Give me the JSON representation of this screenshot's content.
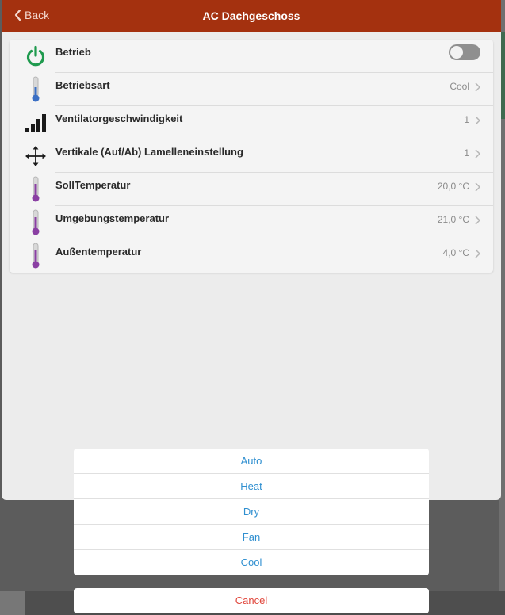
{
  "header": {
    "back_label": "Back",
    "title": "AC Dachgeschoss"
  },
  "rows": [
    {
      "label": "Betrieb",
      "value": "",
      "icon": "power-icon",
      "control": "toggle",
      "toggle_on": false
    },
    {
      "label": "Betriebsart",
      "value": "Cool",
      "icon": "thermometer-blue-icon"
    },
    {
      "label": "Ventilatorgeschwindigkeit",
      "value": "1",
      "icon": "signal-bars-icon"
    },
    {
      "label": "Vertikale (Auf/Ab) Lamelleneinstellung",
      "value": "1",
      "icon": "move-arrows-icon"
    },
    {
      "label": "SollTemperatur",
      "value": "20,0 °C",
      "icon": "thermometer-purple-icon"
    },
    {
      "label": "Umgebungstemperatur",
      "value": "21,0 °C",
      "icon": "thermometer-purple-icon"
    },
    {
      "label": "Außentemperatur",
      "value": "4,0 °C",
      "icon": "thermometer-purple-icon"
    }
  ],
  "action_sheet": {
    "options": [
      "Auto",
      "Heat",
      "Dry",
      "Fan",
      "Cool"
    ],
    "cancel_label": "Cancel"
  },
  "colors": {
    "navbar": "#a4310f",
    "power_green": "#1f9a4e",
    "option_blue": "#2f8fd0",
    "cancel_red": "#e0463b"
  }
}
